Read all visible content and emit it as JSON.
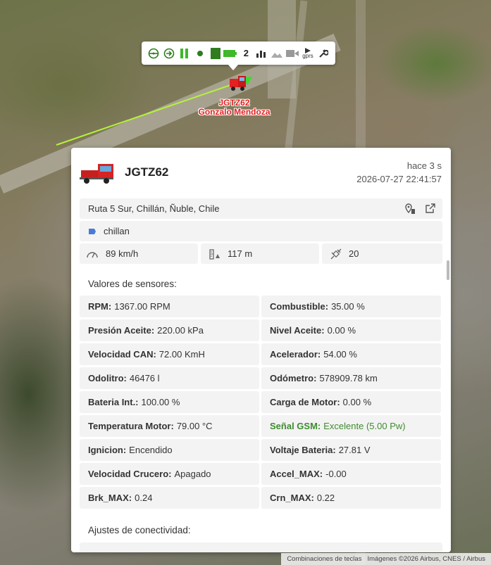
{
  "toolbar": {
    "icons": [
      "steering-wheel-icon",
      "arrow-right-circle-icon",
      "pause-icon",
      "dot-icon",
      "square-icon",
      "battery-icon",
      "number-two-icon",
      "bar-chart-icon",
      "picture-icon",
      "video-camera-icon",
      "gprs-icon",
      "wrench-icon"
    ],
    "gprs_label": "gprs"
  },
  "marker": {
    "plate": "JGTZ62",
    "driver": "Gonzalo Mendoza",
    "color": "#e52020"
  },
  "panel": {
    "plate": "JGTZ62",
    "ago": "hace 3 s",
    "timestamp": "2026-07-27 22:41:57",
    "address": "Ruta 5 Sur, Chillán, Ñuble, Chile",
    "zone": "chillan",
    "speed": "89 km/h",
    "altitude": "117 m",
    "satellites": "20",
    "sensors_title": "Valores de sensores:",
    "connectivity_title": "Ajustes de conectividad:"
  },
  "sensors": [
    {
      "label": "RPM:",
      "value": "1367.00 RPM"
    },
    {
      "label": "Combustible:",
      "value": "35.00 %"
    },
    {
      "label": "Presión Aceite:",
      "value": "220.00 kPa"
    },
    {
      "label": "Nivel Aceite:",
      "value": "0.00 %"
    },
    {
      "label": "Velocidad CAN:",
      "value": "72.00 KmH"
    },
    {
      "label": "Acelerador:",
      "value": "54.00 %"
    },
    {
      "label": "Odolitro:",
      "value": "46476 l"
    },
    {
      "label": "Odómetro:",
      "value": "578909.78 km"
    },
    {
      "label": "Bateria Int.:",
      "value": "100.00 %"
    },
    {
      "label": "Carga de Motor:",
      "value": "0.00 %"
    },
    {
      "label": "Temperatura Motor:",
      "value": "79.00 °C"
    },
    {
      "label": "Señal GSM:",
      "value": "Excelente (5.00 Pw)"
    },
    {
      "label": "Ignicion:",
      "value": "Encendido"
    },
    {
      "label": "Voltaje Bateria:",
      "value": "27.81 V"
    },
    {
      "label": "Velocidad Crucero:",
      "value": "Apagado"
    },
    {
      "label": "Accel_MAX:",
      "value": "-0.00"
    },
    {
      "label": "Brk_MAX:",
      "value": "0.24"
    },
    {
      "label": "Crn_MAX:",
      "value": "0.22"
    }
  ],
  "attribution": {
    "shortcuts": "Combinaciones de teclas",
    "imagery": "Imágenes ©2026 Airbus, CNES / Airbus"
  },
  "colors": {
    "accent_green": "#2f7d1e",
    "gsm_green": "#3f8c2f",
    "marker_red": "#e52020",
    "track": "#b5f23a"
  }
}
